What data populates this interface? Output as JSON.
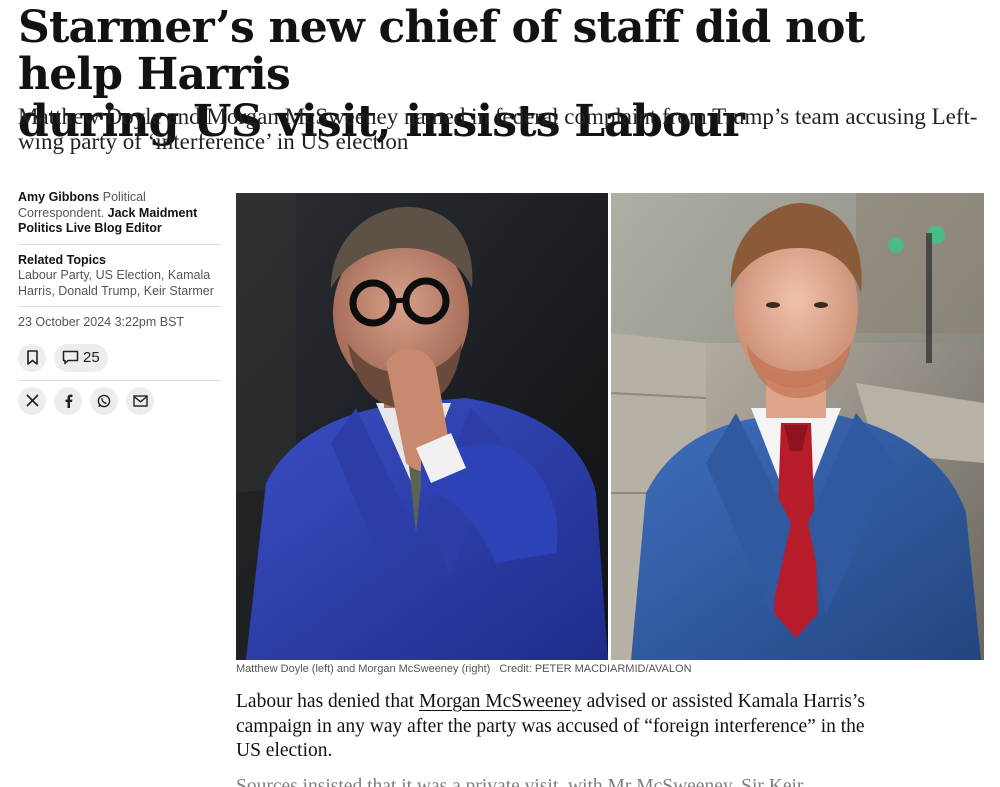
{
  "article": {
    "headline_line1": "Starmer’s new chief of staff did not help Harris",
    "headline_line2": "during US visit, insists Labour",
    "standfirst_line1": "Matthew Doyle and Morgan McSweeney named in federal complaint from Trump’s team accusing Left-",
    "standfirst_line2": "wing party of ‘interference’ in US election"
  },
  "byline": {
    "author1": "Amy Gibbons",
    "role1": "Political Correspondent.",
    "author2": "Jack Maidment",
    "role2": "Politics Live Blog Editor"
  },
  "related": {
    "label": "Related Topics",
    "topics": "Labour Party, US Election, Kamala Harris, Donald Trump, Keir Starmer"
  },
  "date": "23 October 2024 3:22pm BST",
  "comments_count": "25",
  "icons": {
    "bookmark": "bookmark-icon",
    "comment": "comment-icon",
    "x": "x-icon",
    "facebook": "facebook-icon",
    "whatsapp": "whatsapp-icon",
    "email": "email-icon"
  },
  "image": {
    "caption": "Matthew Doyle (left) and Morgan McSweeney (right)",
    "credit": "Credit: PETER MACDIARMID/AVALON"
  },
  "body": {
    "p1_before": "Labour has denied that ",
    "p1_link": "Morgan McSweeney",
    "p1_after": " advised or assisted Kamala Harris’s campaign in any way after the party was accused of “foreign interference” in the US election.",
    "p2_partial": "Sources insisted that it was a private visit, with Mr McSweeney, Sir Keir"
  },
  "colors": {
    "text": "#121212",
    "muted": "#555555",
    "button_bg": "#ededed",
    "rule": "#dcdcdc"
  }
}
